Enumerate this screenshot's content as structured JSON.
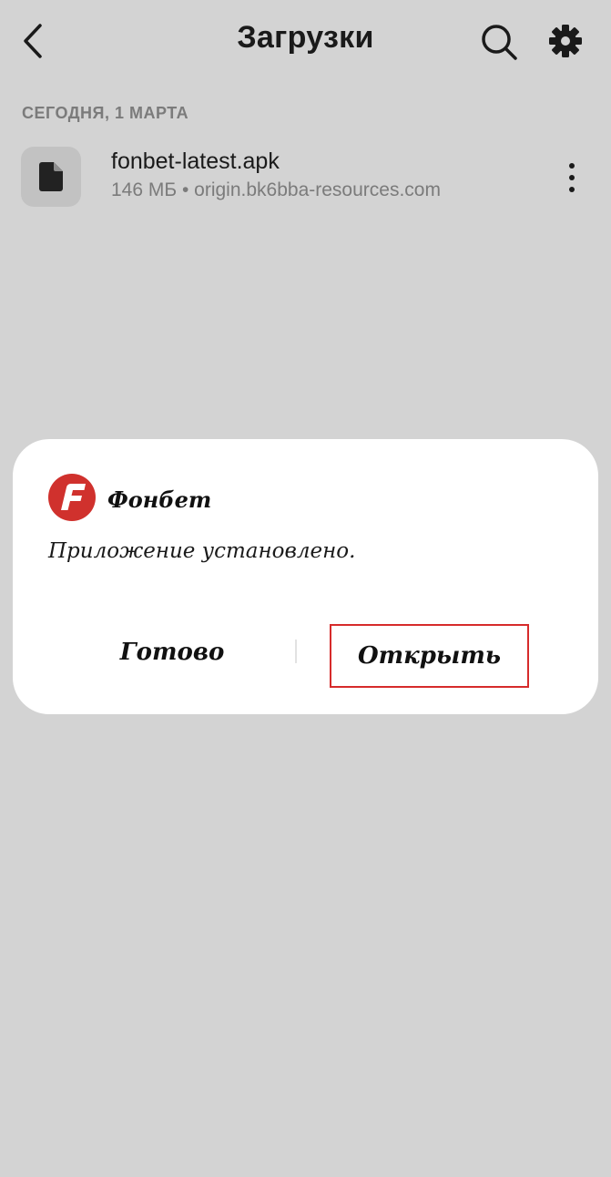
{
  "header": {
    "title": "Загрузки",
    "back_icon": "chevron-left-icon",
    "search_icon": "search-icon",
    "settings_icon": "gear-icon"
  },
  "downloads": {
    "section_title": "СЕГОДНЯ, 1 МАРТА",
    "items": [
      {
        "file_name": "fonbet-latest.apk",
        "meta": "146 МБ • origin.bk6bba-resources.com",
        "icon": "file-icon"
      }
    ]
  },
  "dialog": {
    "app_name": "Фонбет",
    "app_icon": "fonbet-logo",
    "message": "Приложение установлено.",
    "done_label": "Готово",
    "open_label": "Открыть"
  },
  "colors": {
    "background": "#d3d3d3",
    "dialog_background": "#ffffff",
    "brand_red": "#d0312d",
    "highlight_border": "#d62b2b",
    "secondary_text": "#7b7b7b"
  }
}
